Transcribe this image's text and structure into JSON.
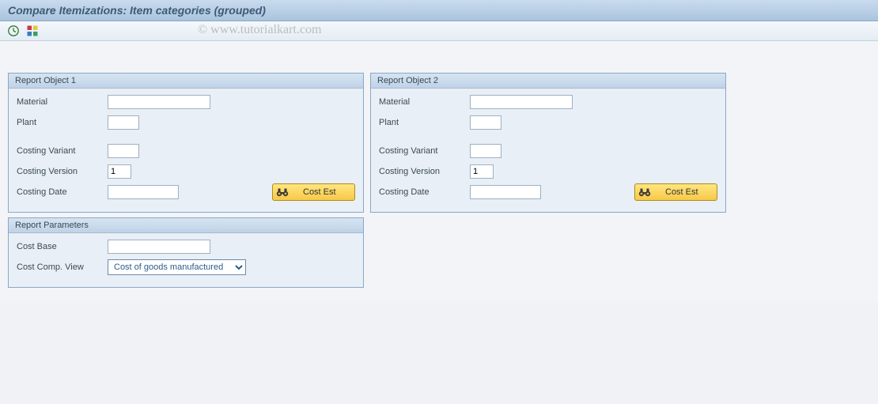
{
  "title": "Compare Itemizations: Item categories (grouped)",
  "watermark": "© www.tutorialkart.com",
  "toolbar": {
    "execute_icon": "execute",
    "grid_icon": "grid"
  },
  "panels": {
    "obj1": {
      "title": "Report Object 1",
      "material_label": "Material",
      "material_value": "",
      "plant_label": "Plant",
      "plant_value": "",
      "costing_variant_label": "Costing Variant",
      "costing_variant_value": "",
      "costing_version_label": "Costing Version",
      "costing_version_value": "1",
      "costing_date_label": "Costing Date",
      "costing_date_value": "",
      "cost_est_btn": "Cost Est"
    },
    "obj2": {
      "title": "Report Object 2",
      "material_label": "Material",
      "material_value": "",
      "plant_label": "Plant",
      "plant_value": "",
      "costing_variant_label": "Costing Variant",
      "costing_variant_value": "",
      "costing_version_label": "Costing Version",
      "costing_version_value": "1",
      "costing_date_label": "Costing Date",
      "costing_date_value": "",
      "cost_est_btn": "Cost Est"
    },
    "params": {
      "title": "Report Parameters",
      "cost_base_label": "Cost Base",
      "cost_base_value": "",
      "cost_comp_view_label": "Cost Comp. View",
      "cost_comp_view_value": "Cost of goods manufactured"
    }
  }
}
